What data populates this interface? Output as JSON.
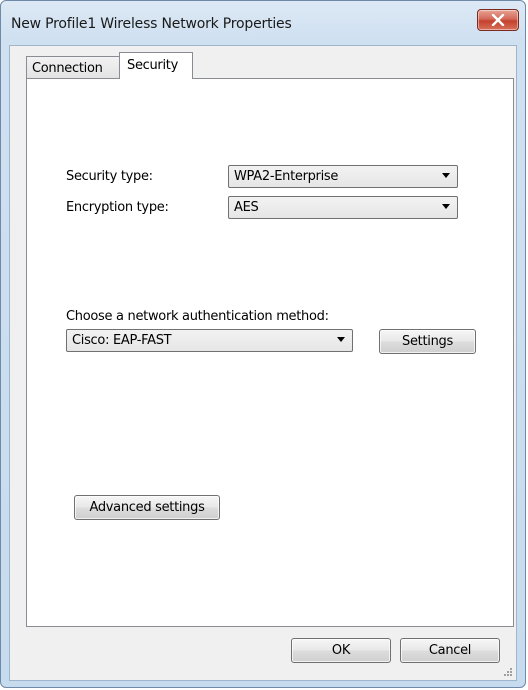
{
  "window": {
    "title": "New Profile1 Wireless Network Properties"
  },
  "tabs": [
    {
      "label": "Connection",
      "selected": false
    },
    {
      "label": "Security",
      "selected": true
    }
  ],
  "security": {
    "security_type_label": "Security type:",
    "security_type_value": "WPA2-Enterprise",
    "encryption_type_label": "Encryption type:",
    "encryption_type_value": "AES",
    "auth_method_label": "Choose a network authentication method:",
    "auth_method_value": "Cisco: EAP-FAST",
    "settings_label": "Settings",
    "advanced_settings_label": "Advanced settings"
  },
  "footer": {
    "ok_label": "OK",
    "cancel_label": "Cancel"
  },
  "colors": {
    "title_bar": "#cfe0f1",
    "close_button": "#c4402c",
    "panel_bg": "#ffffff"
  }
}
